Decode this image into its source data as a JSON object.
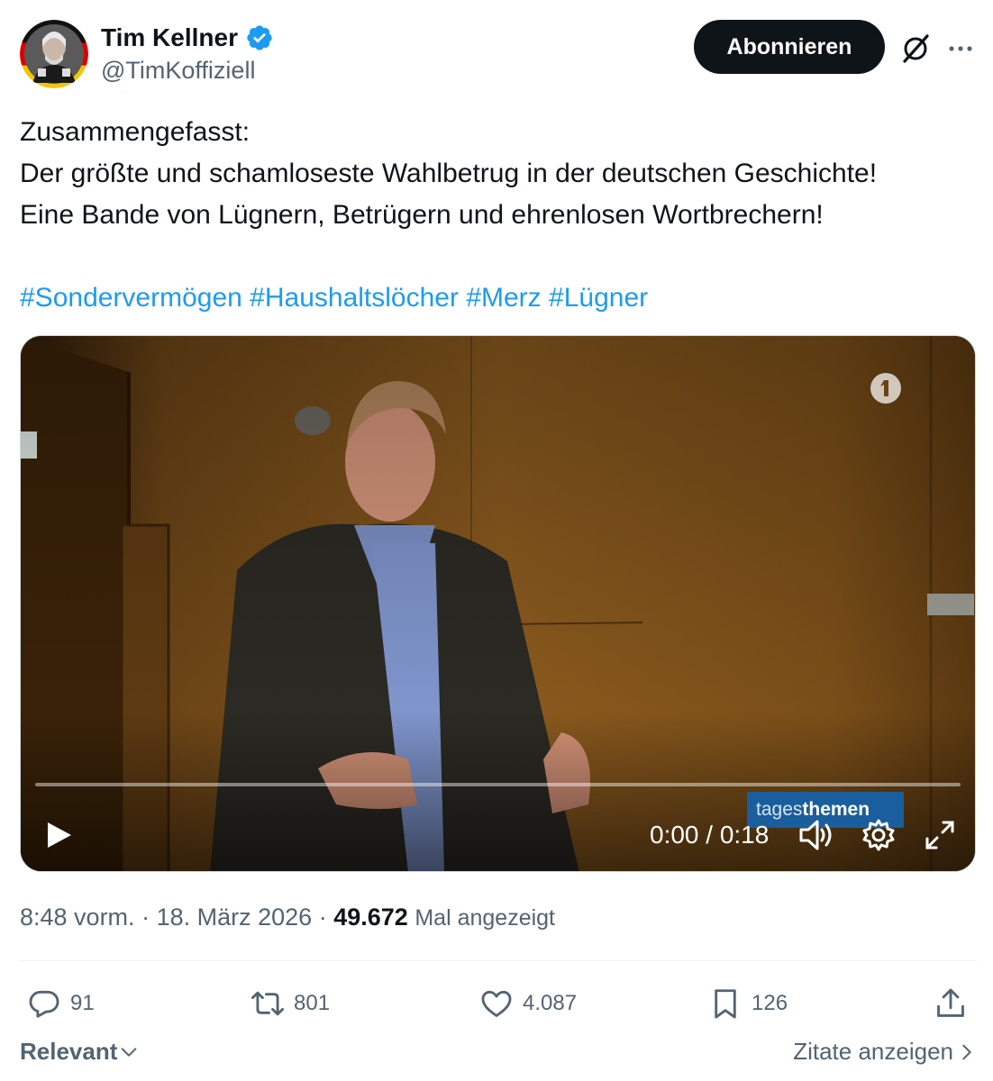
{
  "author": {
    "display_name": "Tim Kellner",
    "handle": "@TimKoffiziell",
    "verified": true
  },
  "header": {
    "subscribe_label": "Abonnieren"
  },
  "tweet": {
    "lines": [
      "Zusammengefasst:",
      "Der größte und schamloseste Wahlbetrug in der deutschen Geschichte!",
      "Eine Bande von Lügnern, Betrügern und ehrenlosen Wortbrechern!"
    ],
    "hashtags": [
      "#Sondervermögen",
      "#Haushaltslöcher",
      "#Merz",
      "#Lügner"
    ]
  },
  "video": {
    "time": "0:00 / 0:18",
    "overlay_prefix": "tages",
    "overlay_bold": "themen",
    "progress": 0
  },
  "meta": {
    "time": "8:48 vorm.",
    "separator": "·",
    "date": "18. März 2026",
    "views": "49.672",
    "views_label": "Mal angezeigt"
  },
  "actions": {
    "replies": "91",
    "reposts": "801",
    "likes": "4.087",
    "bookmarks": "126"
  },
  "footer": {
    "sort_label": "Relevant",
    "quotes_label": "Zitate anzeigen"
  },
  "colors": {
    "accent": "#1d9bf0",
    "text": "#0f1419",
    "secondary": "#536471",
    "button_bg": "#0f1419"
  }
}
